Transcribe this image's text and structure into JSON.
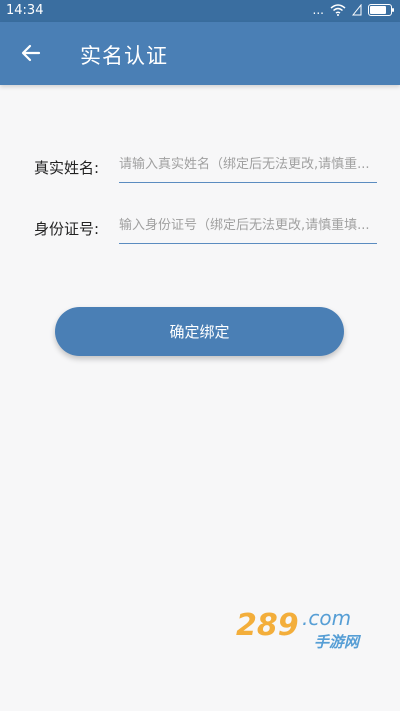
{
  "status_bar": {
    "time": "14:34",
    "signal_text": "...",
    "battery_level": 0.9
  },
  "header": {
    "title": "实名认证"
  },
  "form": {
    "real_name": {
      "label": "真实姓名:",
      "placeholder": "请输入真实姓名（绑定后无法更改,请慎重..."
    },
    "id_number": {
      "label": "身份证号:",
      "placeholder": "输入身份证号（绑定后无法更改,请慎重填..."
    }
  },
  "actions": {
    "confirm_label": "确定绑定"
  },
  "watermark": {
    "text": "289.com 手游网",
    "brand_color": "#f3a21b"
  },
  "colors": {
    "primary": "#4a7fb5",
    "status_bar": "#3a6ea0"
  }
}
